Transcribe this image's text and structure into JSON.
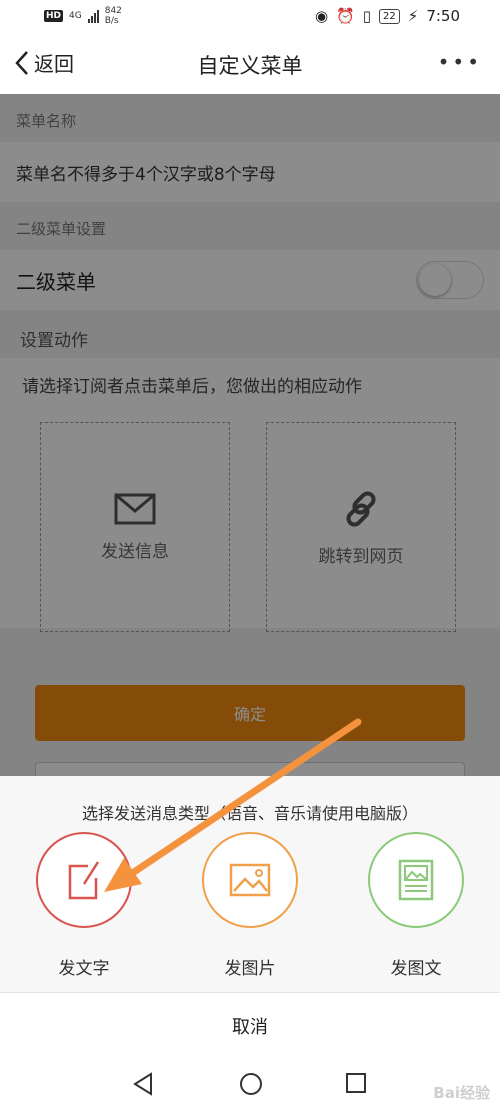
{
  "status_bar": {
    "network_badge": "HD",
    "signal_type": "4G",
    "data_rate_value": "842",
    "data_rate_unit": "B/s",
    "battery": "22",
    "time": "7:50"
  },
  "nav": {
    "back_label": "返回",
    "title": "自定义菜单",
    "more": "•••"
  },
  "form": {
    "menu_name_label": "菜单名称",
    "menu_name_placeholder": "菜单名不得多于4个汉字或8个字母",
    "submenu_section_label": "二级菜单设置",
    "submenu_label": "二级菜单",
    "submenu_enabled": false,
    "action_section_label": "设置动作",
    "action_description": "请选择订阅者点击菜单后，您做出的相应动作",
    "actions": [
      {
        "label": "发送信息",
        "icon": "mail-icon"
      },
      {
        "label": "跳转到网页",
        "icon": "link-icon"
      }
    ],
    "confirm_label": "确定"
  },
  "sheet": {
    "title": "选择发送消息类型（语音、音乐请使用电脑版）",
    "options": [
      {
        "label": "发文字",
        "icon": "edit-text-icon",
        "color": "#d9534f"
      },
      {
        "label": "发图片",
        "icon": "image-icon",
        "color": "#f0a04b"
      },
      {
        "label": "发图文",
        "icon": "image-text-icon",
        "color": "#8cc97a"
      }
    ],
    "cancel_label": "取消"
  },
  "colors": {
    "accent_orange": "#f08a10",
    "annotation_arrow": "#f5923e"
  },
  "watermark": "Bai经验"
}
